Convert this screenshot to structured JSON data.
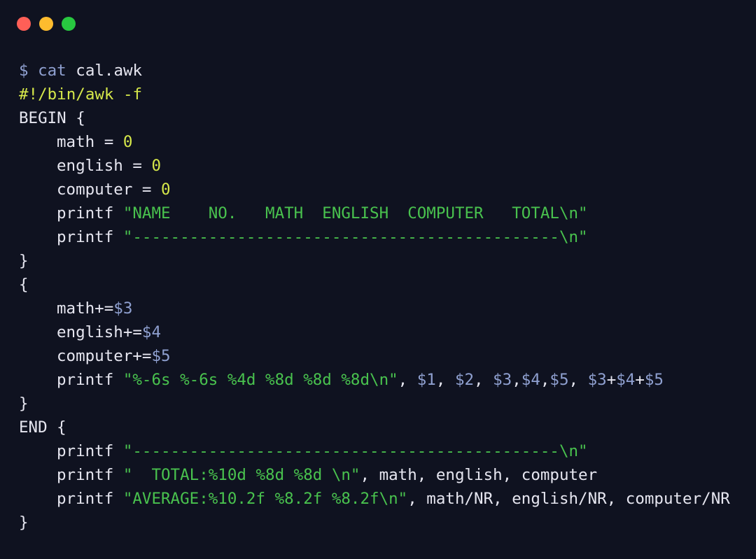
{
  "window": {
    "traffic_lights": [
      {
        "name": "close",
        "color": "#ff5f57"
      },
      {
        "name": "minimize",
        "color": "#febc2e"
      },
      {
        "name": "maximize",
        "color": "#28c840"
      }
    ]
  },
  "colors": {
    "background": "#0f1220",
    "text": "#e6e6f0",
    "prompt": "#8fa0d0",
    "variable": "#8fa0d0",
    "number": "#d6e84a",
    "string": "#49c24e",
    "shebang": "#d6e84a"
  },
  "terminal": {
    "lines": [
      {
        "indent": false,
        "tokens": [
          {
            "t": "$ cat",
            "c": "prompt"
          },
          {
            "t": " cal.awk",
            "c": "text"
          }
        ]
      },
      {
        "indent": false,
        "tokens": [
          {
            "t": "#!/bin/awk -f",
            "c": "shebang"
          }
        ]
      },
      {
        "indent": false,
        "tokens": [
          {
            "t": "BEGIN {",
            "c": "text"
          }
        ]
      },
      {
        "indent": true,
        "tokens": [
          {
            "t": "math = ",
            "c": "text"
          },
          {
            "t": "0",
            "c": "number"
          }
        ]
      },
      {
        "indent": true,
        "tokens": [
          {
            "t": "english = ",
            "c": "text"
          },
          {
            "t": "0",
            "c": "number"
          }
        ]
      },
      {
        "indent": true,
        "tokens": [
          {
            "t": "computer = ",
            "c": "text"
          },
          {
            "t": "0",
            "c": "number"
          }
        ]
      },
      {
        "indent": true,
        "tokens": [
          {
            "t": "printf ",
            "c": "text"
          },
          {
            "t": "\"NAME    NO.   MATH  ENGLISH  COMPUTER   TOTAL\\n\"",
            "c": "string"
          }
        ]
      },
      {
        "indent": true,
        "tokens": [
          {
            "t": "printf ",
            "c": "text"
          },
          {
            "t": "\"---------------------------------------------\\n\"",
            "c": "string"
          }
        ]
      },
      {
        "indent": false,
        "tokens": [
          {
            "t": "}",
            "c": "text"
          }
        ]
      },
      {
        "indent": false,
        "tokens": [
          {
            "t": "{",
            "c": "text"
          }
        ]
      },
      {
        "indent": true,
        "tokens": [
          {
            "t": "math+=",
            "c": "text"
          },
          {
            "t": "$3",
            "c": "variable"
          }
        ]
      },
      {
        "indent": true,
        "tokens": [
          {
            "t": "english+=",
            "c": "text"
          },
          {
            "t": "$4",
            "c": "variable"
          }
        ]
      },
      {
        "indent": true,
        "tokens": [
          {
            "t": "computer+=",
            "c": "text"
          },
          {
            "t": "$5",
            "c": "variable"
          }
        ]
      },
      {
        "indent": true,
        "tokens": [
          {
            "t": "printf ",
            "c": "text"
          },
          {
            "t": "\"%-6s %-6s %4d %8d %8d %8d\\n\"",
            "c": "string"
          },
          {
            "t": ", ",
            "c": "text"
          },
          {
            "t": "$1",
            "c": "variable"
          },
          {
            "t": ", ",
            "c": "text"
          },
          {
            "t": "$2",
            "c": "variable"
          },
          {
            "t": ", ",
            "c": "text"
          },
          {
            "t": "$3",
            "c": "variable"
          },
          {
            "t": ",",
            "c": "text"
          },
          {
            "t": "$4",
            "c": "variable"
          },
          {
            "t": ",",
            "c": "text"
          },
          {
            "t": "$5",
            "c": "variable"
          },
          {
            "t": ", ",
            "c": "text"
          },
          {
            "t": "$3",
            "c": "variable"
          },
          {
            "t": "+",
            "c": "text"
          },
          {
            "t": "$4",
            "c": "variable"
          },
          {
            "t": "+",
            "c": "text"
          },
          {
            "t": "$5",
            "c": "variable"
          }
        ]
      },
      {
        "indent": false,
        "tokens": [
          {
            "t": "}",
            "c": "text"
          }
        ]
      },
      {
        "indent": false,
        "tokens": [
          {
            "t": "END {",
            "c": "text"
          }
        ]
      },
      {
        "indent": true,
        "tokens": [
          {
            "t": "printf ",
            "c": "text"
          },
          {
            "t": "\"---------------------------------------------\\n\"",
            "c": "string"
          }
        ]
      },
      {
        "indent": true,
        "tokens": [
          {
            "t": "printf ",
            "c": "text"
          },
          {
            "t": "\"  TOTAL:%10d %8d %8d \\n\"",
            "c": "string"
          },
          {
            "t": ", math, english, computer",
            "c": "text"
          }
        ]
      },
      {
        "indent": true,
        "tokens": [
          {
            "t": "printf ",
            "c": "text"
          },
          {
            "t": "\"AVERAGE:%10.2f %8.2f %8.2f\\n\"",
            "c": "string"
          },
          {
            "t": ", math/NR, english/NR, computer/NR",
            "c": "text"
          }
        ]
      },
      {
        "indent": false,
        "tokens": [
          {
            "t": "}",
            "c": "text"
          }
        ]
      }
    ]
  }
}
